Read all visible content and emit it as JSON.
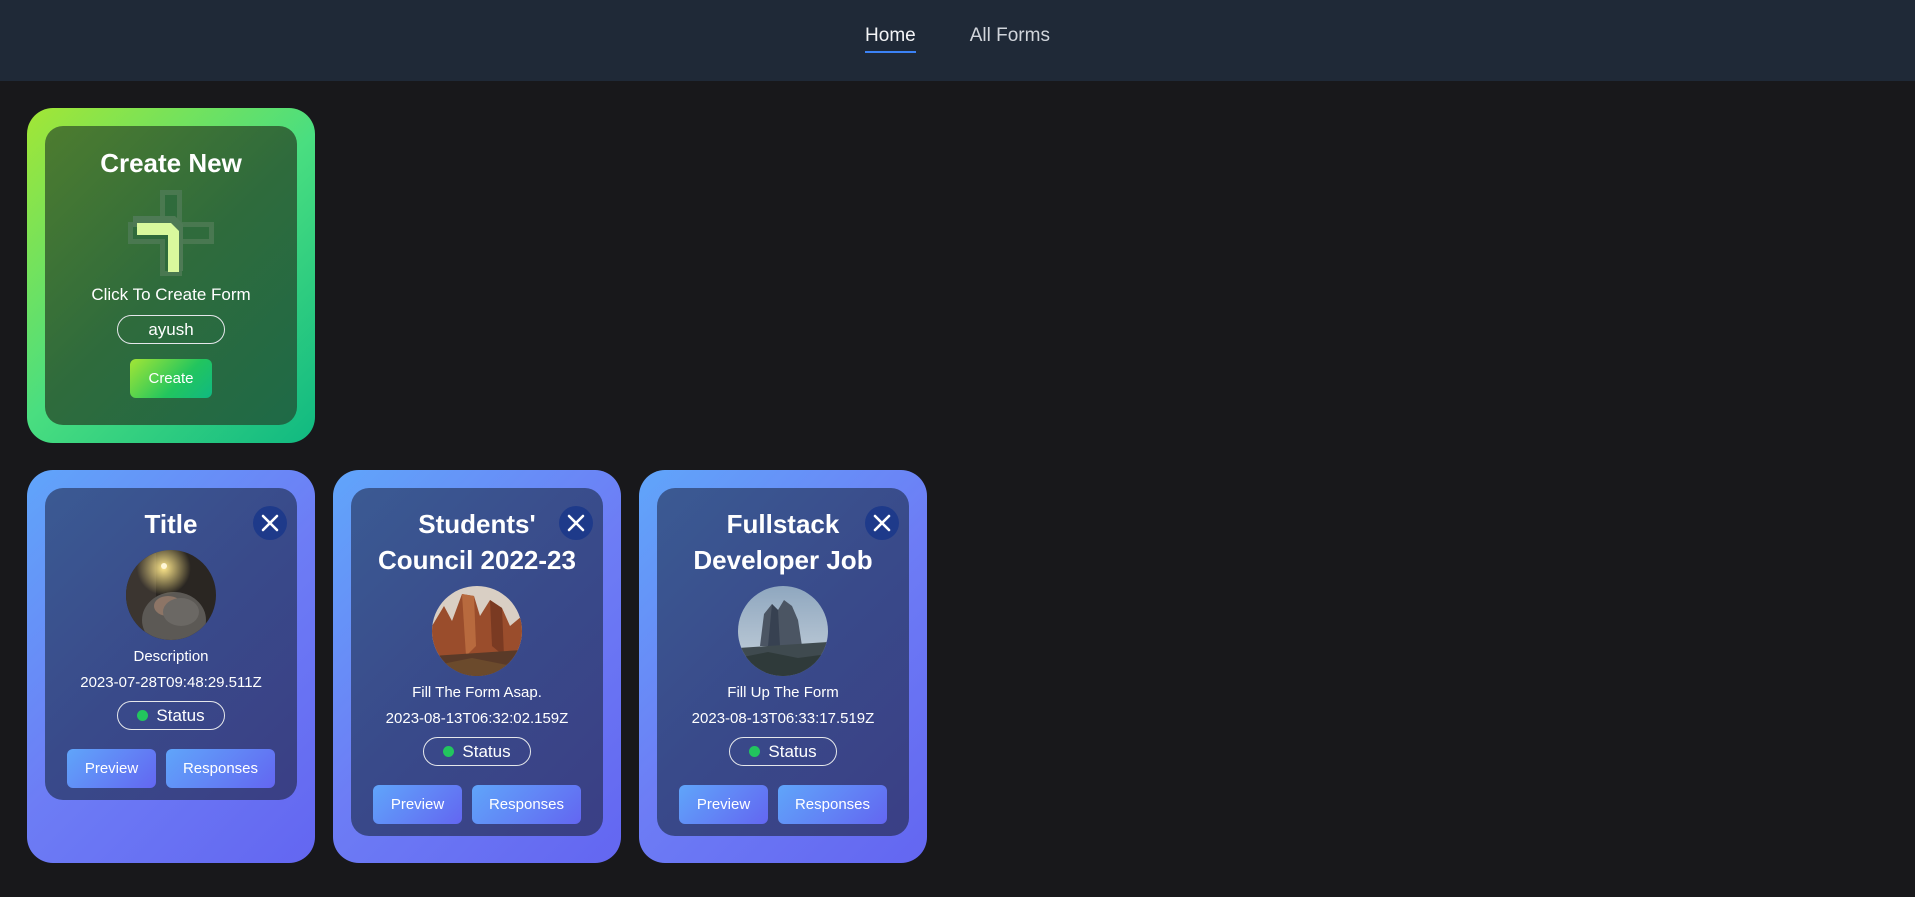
{
  "nav": {
    "items": [
      {
        "label": "Home",
        "active": true
      },
      {
        "label": "All Forms",
        "active": false
      }
    ],
    "accent": "#3b82f6"
  },
  "create_card": {
    "title": "Create New",
    "subtitle": "Click To Create Form",
    "input_value": "ayush",
    "button_label": "Create",
    "icon": "plus-icon"
  },
  "forms": [
    {
      "title": "Title",
      "description": "Description",
      "date": "2023-07-28T09:48:29.511Z",
      "status": "Status",
      "preview_label": "Preview",
      "responses_label": "Responses"
    },
    {
      "title": "Students' Council 2022-23",
      "description": "Fill The Form Asap.",
      "date": "2023-08-13T06:32:02.159Z",
      "status": "Status",
      "preview_label": "Preview",
      "responses_label": "Responses"
    },
    {
      "title": "Fullstack Developer Job",
      "description": "Fill Up The Form",
      "date": "2023-08-13T06:33:17.519Z",
      "status": "Status",
      "preview_label": "Preview",
      "responses_label": "Responses"
    }
  ],
  "colors": {
    "status_dot": "#22c55e",
    "create_gradient": "#a3e635",
    "form_gradient": "#6366f1"
  }
}
